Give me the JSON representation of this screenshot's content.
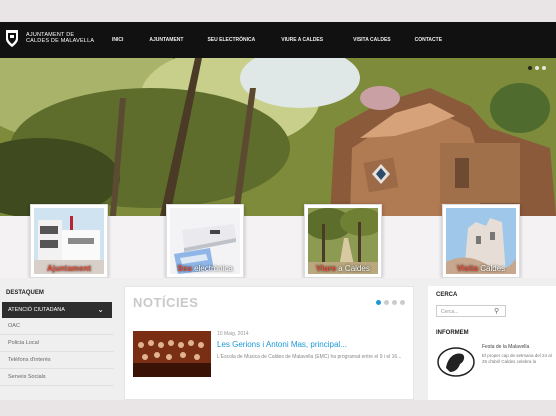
{
  "header": {
    "logo_line1": "AJUNTAMENT DE",
    "logo_line2": "CALDES DE MALAVELLA",
    "nav": [
      "Inici",
      "Ajuntament",
      "Seu electrònica",
      "Viure a Caldes",
      "Visita Caldes",
      "Contacte"
    ]
  },
  "tiles": [
    {
      "label": "Ajuntament"
    },
    {
      "label_accent": "Seu",
      "label_rest": " electrònica"
    },
    {
      "label_accent": "Viure",
      "label_rest": " a Caldes"
    },
    {
      "label_accent": "Visita",
      "label_rest": " Caldes"
    }
  ],
  "sidebar": {
    "title": "DESTAQUEM",
    "dropdown_label": "ATENCIÓ CIUTADANA",
    "links": [
      "OAC",
      "Policia Local",
      "Telèfons d'interès",
      "Serveis Socials"
    ]
  },
  "news": {
    "title": "NOTÍCIES",
    "date": "10 Maig, 2014",
    "headline": "Les Gerions i Antoni Mas, principal...",
    "description": "L'Escola de Música de Caldes de Malavella (EMC) ha programat entre el 9 i el 16..."
  },
  "search": {
    "title": "CERCA",
    "placeholder": "Cerca..."
  },
  "inform": {
    "title": "INFORMEM",
    "heading": "Festa de la Malavella",
    "text": "El proper cap de setmana del 24 al 25 d'abril Caldes celebra la"
  },
  "colors": {
    "accent": "#1b98d6",
    "tile_accent": "#e8503a",
    "header_bg": "#111111"
  }
}
